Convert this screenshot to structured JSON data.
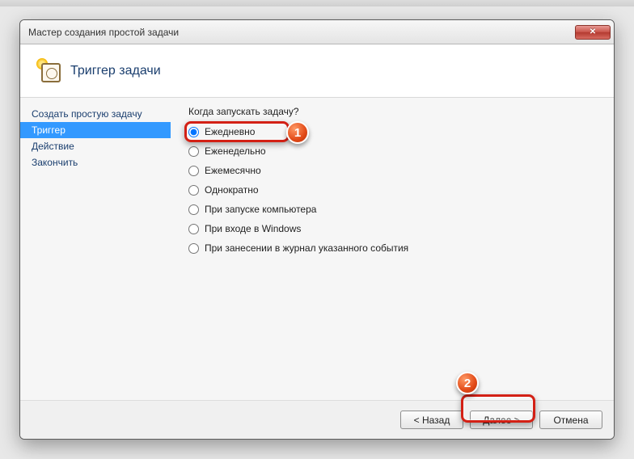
{
  "window": {
    "title": "Мастер создания простой задачи"
  },
  "header": {
    "title": "Триггер задачи"
  },
  "sidebar": {
    "items": [
      {
        "label": "Создать простую задачу",
        "selected": false
      },
      {
        "label": "Триггер",
        "selected": true
      },
      {
        "label": "Действие",
        "selected": false
      },
      {
        "label": "Закончить",
        "selected": false
      }
    ]
  },
  "content": {
    "prompt": "Когда запускать задачу?",
    "options": [
      {
        "label": "Ежедневно",
        "checked": true
      },
      {
        "label": "Еженедельно",
        "checked": false
      },
      {
        "label": "Ежемесячно",
        "checked": false
      },
      {
        "label": "Однократно",
        "checked": false
      },
      {
        "label": "При запуске компьютера",
        "checked": false
      },
      {
        "label": "При входе в Windows",
        "checked": false
      },
      {
        "label": "При занесении в журнал указанного события",
        "checked": false
      }
    ]
  },
  "footer": {
    "back": "< Назад",
    "next": "Далее >",
    "cancel": "Отмена"
  },
  "annotations": {
    "badge1": "1",
    "badge2": "2"
  }
}
